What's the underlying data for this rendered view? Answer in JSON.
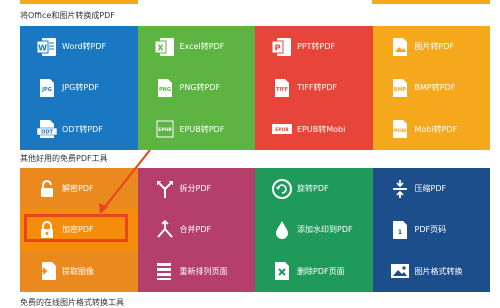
{
  "section1": {
    "title": "将Office和图片转换成PDF",
    "tiles": [
      {
        "label": "Word转PDF",
        "icon": "word-doc-icon",
        "color": "#1a78c2"
      },
      {
        "label": "Excel转PDF",
        "icon": "excel-icon",
        "color": "#5db443"
      },
      {
        "label": "PPT转PDF",
        "icon": "ppt-icon",
        "color": "#e8453a"
      },
      {
        "label": "图片转PDF",
        "icon": "image-file-icon",
        "color": "#f5a81c"
      },
      {
        "label": "JPG转PDF",
        "icon": "jpg-file-icon",
        "color": "#1a78c2"
      },
      {
        "label": "PNG转PDF",
        "icon": "png-file-icon",
        "color": "#5db443"
      },
      {
        "label": "TIFF转PDF",
        "icon": "tiff-file-icon",
        "color": "#e8453a"
      },
      {
        "label": "BMP转PDF",
        "icon": "bmp-file-icon",
        "color": "#f5a81c"
      },
      {
        "label": "ODT转PDF",
        "icon": "odt-file-icon",
        "color": "#1a78c2"
      },
      {
        "label": "EPUB转PDF",
        "icon": "epub-file-icon",
        "color": "#5db443"
      },
      {
        "label": "EPUB转Mobi",
        "icon": "epub-mobi-icon",
        "color": "#e8453a"
      },
      {
        "label": "Mobi转PDF",
        "icon": "mobi-file-icon",
        "color": "#f5a81c"
      }
    ]
  },
  "section2": {
    "title": "其他好用的免费PDF工具",
    "tiles": [
      {
        "label": "解密PDF",
        "icon": "unlock-icon",
        "color": "#ea8a1e"
      },
      {
        "label": "拆分PDF",
        "icon": "split-icon",
        "color": "#b43f6b"
      },
      {
        "label": "旋转PDF",
        "icon": "rotate-icon",
        "color": "#1f9a5a"
      },
      {
        "label": "压缩PDF",
        "icon": "compress-icon",
        "color": "#1d4e8c"
      },
      {
        "label": "加密PDF",
        "icon": "lock-icon",
        "color": "#f58c0a"
      },
      {
        "label": "合并PDF",
        "icon": "merge-icon",
        "color": "#b43f6b"
      },
      {
        "label": "添加水印到PDF",
        "icon": "watermark-drop-icon",
        "color": "#1f9a5a"
      },
      {
        "label": "PDF页码",
        "icon": "page-number-icon",
        "color": "#1d4e8c"
      },
      {
        "label": "提取图像",
        "icon": "extract-image-icon",
        "color": "#ea8a1e"
      },
      {
        "label": "重新排列页面",
        "icon": "reorder-pages-icon",
        "color": "#b43f6b"
      },
      {
        "label": "删除PDF页面",
        "icon": "delete-page-icon",
        "color": "#1f9a5a"
      },
      {
        "label": "图片格式转换",
        "icon": "image-convert-icon",
        "color": "#1d4e8c"
      }
    ]
  },
  "section3": {
    "title": "免费的在线图片格式转换工具"
  },
  "top_strip_colors": [
    "#f5a81c",
    "#f5a81c"
  ],
  "highlight_color": "#e8451e",
  "arrow_color": "#e8451e"
}
